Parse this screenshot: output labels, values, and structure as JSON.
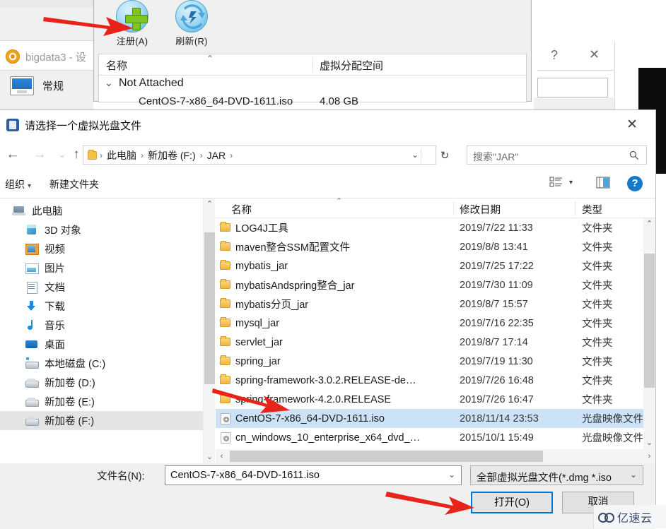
{
  "background_window": {
    "title": "bigdata3 - 设",
    "sidebar_item": "常规",
    "help_symbol": "?",
    "close_symbol": "✕"
  },
  "media_manager": {
    "tools": [
      {
        "label": "注册(A)",
        "icon": "add-disc-icon"
      },
      {
        "label": "刷新(R)",
        "icon": "refresh-icon"
      }
    ],
    "columns": [
      "名称",
      "虚拟分配空间"
    ],
    "group": {
      "label": "Not Attached",
      "chevron": "⌄"
    },
    "rows": [
      {
        "name": "CentOS-7-x86_64-DVD-1611.iso",
        "size": "4.08 GB"
      }
    ]
  },
  "dialog": {
    "title": "请选择一个虚拟光盘文件",
    "close_symbol": "✕",
    "nav": {
      "back": "←",
      "forward": "→",
      "recent": "⌄",
      "up": "↑",
      "breadcrumbs": [
        "此电脑",
        "新加卷 (F:)",
        "JAR"
      ],
      "breadcrumb_separator": "›",
      "address_caret": "⌄",
      "refresh": "↻",
      "search_placeholder": "搜索\"JAR\"",
      "search_icon": "search-icon"
    },
    "commandbar": {
      "organize": "组织",
      "organize_caret": "▾",
      "new_folder": "新建文件夹",
      "view_icon": "view-list-icon",
      "view_caret": "▾",
      "preview_icon": "preview-pane-icon",
      "help_icon": "help-icon",
      "help_glyph": "?"
    },
    "nav_pane": {
      "items": [
        {
          "label": "此电脑",
          "icon": "computer-icon",
          "indent": 0,
          "selected": false
        },
        {
          "label": "3D 对象",
          "icon": "3d-objects-icon",
          "indent": 1,
          "selected": false
        },
        {
          "label": "视频",
          "icon": "videos-icon",
          "indent": 1,
          "selected": false
        },
        {
          "label": "图片",
          "icon": "pictures-icon",
          "indent": 1,
          "selected": false
        },
        {
          "label": "文档",
          "icon": "documents-icon",
          "indent": 1,
          "selected": false
        },
        {
          "label": "下载",
          "icon": "downloads-icon",
          "indent": 1,
          "selected": false
        },
        {
          "label": "音乐",
          "icon": "music-icon",
          "indent": 1,
          "selected": false
        },
        {
          "label": "桌面",
          "icon": "desktop-icon",
          "indent": 1,
          "selected": false
        },
        {
          "label": "本地磁盘 (C:)",
          "icon": "local-disk-icon",
          "indent": 1,
          "selected": false
        },
        {
          "label": "新加卷 (D:)",
          "icon": "drive-icon",
          "indent": 1,
          "selected": false
        },
        {
          "label": "新加卷 (E:)",
          "icon": "drive-icon",
          "indent": 1,
          "selected": false
        },
        {
          "label": "新加卷 (F:)",
          "icon": "drive-icon",
          "indent": 1,
          "selected": true
        }
      ],
      "scroll_up": "⌃",
      "scroll_down": "⌄"
    },
    "file_list": {
      "columns": [
        "名称",
        "修改日期",
        "类型"
      ],
      "sort_mark": "⌃",
      "rows": [
        {
          "name": "LOG4J工具",
          "date": "2019/7/22 11:33",
          "type": "文件夹",
          "icon": "folder-icon",
          "selected": false
        },
        {
          "name": "maven整合SSM配置文件",
          "date": "2019/8/8 13:41",
          "type": "文件夹",
          "icon": "folder-icon",
          "selected": false
        },
        {
          "name": "mybatis_jar",
          "date": "2019/7/25 17:22",
          "type": "文件夹",
          "icon": "folder-icon",
          "selected": false
        },
        {
          "name": "mybatisAndspring整合_jar",
          "date": "2019/7/30 11:09",
          "type": "文件夹",
          "icon": "folder-icon",
          "selected": false
        },
        {
          "name": "mybatis分页_jar",
          "date": "2019/8/7 15:57",
          "type": "文件夹",
          "icon": "folder-icon",
          "selected": false
        },
        {
          "name": "mysql_jar",
          "date": "2019/7/16 22:35",
          "type": "文件夹",
          "icon": "folder-icon",
          "selected": false
        },
        {
          "name": "servlet_jar",
          "date": "2019/8/7 17:14",
          "type": "文件夹",
          "icon": "folder-icon",
          "selected": false
        },
        {
          "name": "spring_jar",
          "date": "2019/7/19 11:30",
          "type": "文件夹",
          "icon": "folder-icon",
          "selected": false
        },
        {
          "name": "spring-framework-3.0.2.RELEASE-de…",
          "date": "2019/7/26 16:48",
          "type": "文件夹",
          "icon": "folder-icon",
          "selected": false
        },
        {
          "name": "spring-framework-4.2.0.RELEASE",
          "date": "2019/7/26 16:47",
          "type": "文件夹",
          "icon": "folder-icon",
          "selected": false
        },
        {
          "name": "CentOS-7-x86_64-DVD-1611.iso",
          "date": "2018/11/14 23:53",
          "type": "光盘映像文件",
          "icon": "iso-file-icon",
          "selected": true
        },
        {
          "name": "cn_windows_10_enterprise_x64_dvd_…",
          "date": "2015/10/1 15:49",
          "type": "光盘映像文件",
          "icon": "iso-file-icon",
          "selected": false
        }
      ],
      "vscroll_up": "⌃",
      "vscroll_down": "⌄",
      "hscroll_left": "‹",
      "hscroll_right": "›"
    },
    "footer": {
      "filename_label": "文件名(N):",
      "filename_value": "CentOS-7-x86_64-DVD-1611.iso",
      "filename_caret": "⌄",
      "filetype_value": "全部虚拟光盘文件(*.dmg *.iso",
      "filetype_caret": "⌄",
      "open_button": "打开(O)",
      "cancel_button": "取消"
    }
  },
  "watermark": {
    "text": "亿速云"
  },
  "annotations": {
    "arrow_color": "#e8241a",
    "arrows": [
      {
        "name": "arrow-to-register-button"
      },
      {
        "name": "arrow-to-selected-iso-row"
      },
      {
        "name": "arrow-to-open-button"
      }
    ]
  }
}
